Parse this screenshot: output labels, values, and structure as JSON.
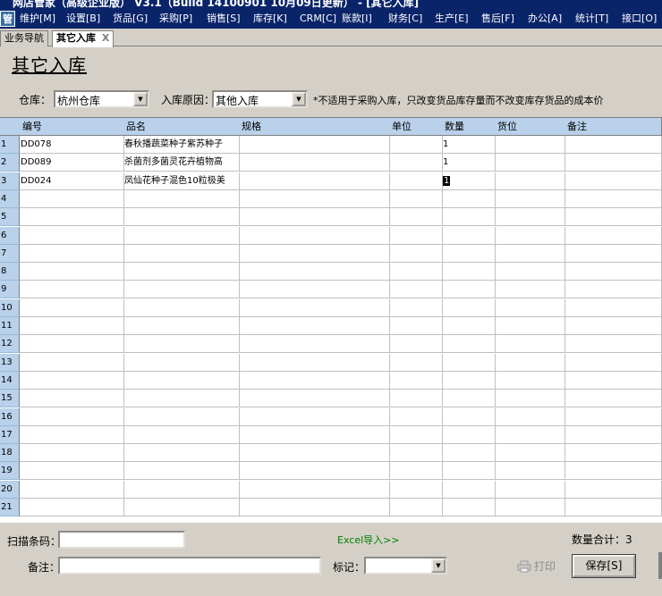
{
  "window": {
    "title": "网店管家（高级企业版） V3.1（Build 14100901 10月09日更新） - [其它入库]"
  },
  "app_icon": "管",
  "menu": [
    {
      "label": "维护[M]"
    },
    {
      "label": "设置[B]"
    },
    {
      "label": "货品[G]"
    },
    {
      "label": "采购[P]"
    },
    {
      "label": "销售[S]"
    },
    {
      "label": "库存[K]"
    },
    {
      "label": "CRM[C]"
    },
    {
      "label": "账款[I]"
    },
    {
      "label": "财务[C]"
    },
    {
      "label": "生产[E]"
    },
    {
      "label": "售后[F]"
    },
    {
      "label": "办公[A]"
    },
    {
      "label": "统计[T]"
    },
    {
      "label": "接口[O]"
    }
  ],
  "tabs": [
    {
      "label": "业务导航"
    },
    {
      "label": "其它入库",
      "close": "X"
    }
  ],
  "page_title": "其它入库",
  "filters": {
    "warehouse_label": "仓库：",
    "warehouse_value": "杭州仓库",
    "reason_label": "入库原因：",
    "reason_value": "其他入库",
    "note": "*不适用于采购入库，只改变货品库存量而不改变库存货品的成本价"
  },
  "grid": {
    "columns": [
      "编号",
      "品名",
      "规格",
      "单位",
      "数量",
      "货位",
      "备注"
    ],
    "rows": [
      {
        "num": "1",
        "code": "DD078",
        "name": "春秋播蔬菜种子紫苏种子",
        "spec": "",
        "unit": "",
        "qty": "1",
        "loc": "",
        "remark": ""
      },
      {
        "num": "2",
        "code": "DD089",
        "name": "杀菌剂多菌灵花卉植物高",
        "spec": "",
        "unit": "",
        "qty": "1",
        "loc": "",
        "remark": ""
      },
      {
        "num": "3",
        "code": "DD024",
        "name": "凤仙花种子混色10粒极美",
        "spec": "",
        "unit": "",
        "qty": "1",
        "loc": "",
        "remark": ""
      },
      {
        "num": "4"
      },
      {
        "num": "5"
      },
      {
        "num": "6"
      },
      {
        "num": "7"
      },
      {
        "num": "8"
      },
      {
        "num": "9"
      },
      {
        "num": "10"
      },
      {
        "num": "11"
      },
      {
        "num": "12"
      },
      {
        "num": "13"
      },
      {
        "num": "14"
      },
      {
        "num": "15"
      },
      {
        "num": "16"
      },
      {
        "num": "17"
      },
      {
        "num": "18"
      },
      {
        "num": "19"
      },
      {
        "num": "20"
      },
      {
        "num": "21"
      }
    ]
  },
  "bottom": {
    "scan_label": "扫描条码：",
    "scan_value": "",
    "excel_import": "Excel导入>>",
    "qty_total_label": "数量合计：",
    "qty_total_value": "3",
    "remark_label": "备注：",
    "remark_value": "",
    "tag_label": "标记：",
    "tag_value": "",
    "print_label": "打印",
    "save_label": "保存[S]"
  },
  "colors": {
    "title_bar": "#0a246a",
    "grid_header": "#b9d1ea",
    "excel_link": "#008000",
    "window_bg": "#d4d0c8"
  }
}
